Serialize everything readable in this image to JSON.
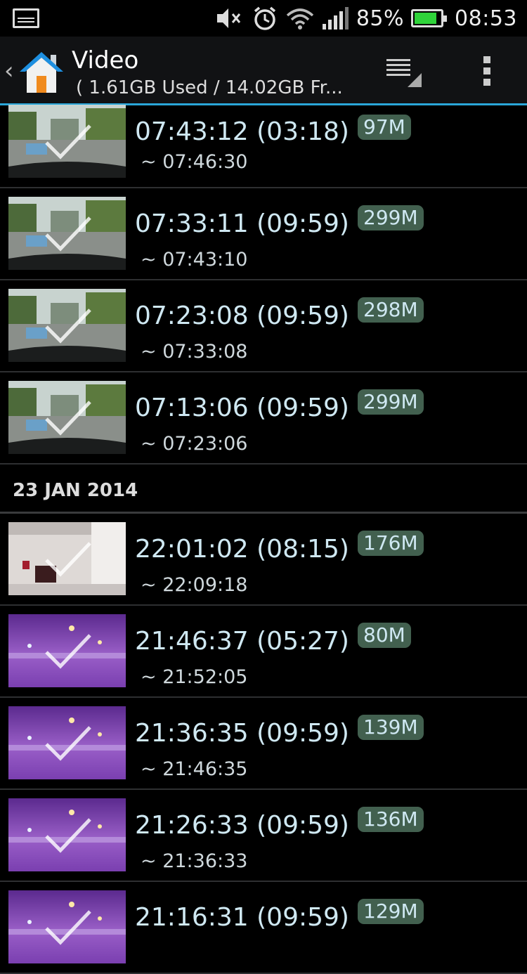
{
  "status_bar": {
    "battery_percent_text": "85%",
    "battery_level": 0.85,
    "clock": "08:53",
    "icons": [
      "notification-icon",
      "mute-icon",
      "alarm-icon",
      "wifi-icon",
      "signal-icon",
      "battery-icon"
    ]
  },
  "action_bar": {
    "title": "Video",
    "subtitle": "( 1.61GB Used / 14.02GB Fr...",
    "icons": [
      "back-chevron-icon",
      "home-icon",
      "list-menu-icon",
      "overflow-menu-icon"
    ]
  },
  "colors": {
    "accent": "#2aa6d8",
    "badge_bg": "#42604f",
    "text_primary": "#cfe8f2"
  },
  "list": {
    "group1_items": [
      {
        "start": "07:43:12 (03:18)",
        "size": "97M",
        "end": "~ 07:46:30",
        "thumb": "day"
      },
      {
        "start": "07:33:11 (09:59)",
        "size": "299M",
        "end": "~ 07:43:10",
        "thumb": "day"
      },
      {
        "start": "07:23:08 (09:59)",
        "size": "298M",
        "end": "~ 07:33:08",
        "thumb": "day"
      },
      {
        "start": "07:13:06 (09:59)",
        "size": "299M",
        "end": "~ 07:23:06",
        "thumb": "day"
      }
    ],
    "section_header": "23 JAN 2014",
    "group2_items": [
      {
        "start": "22:01:02 (08:15)",
        "size": "176M",
        "end": "~ 22:09:18",
        "thumb": "room"
      },
      {
        "start": "21:46:37 (05:27)",
        "size": "80M",
        "end": "~ 21:52:05",
        "thumb": "night"
      },
      {
        "start": "21:36:35 (09:59)",
        "size": "139M",
        "end": "~ 21:46:35",
        "thumb": "night"
      },
      {
        "start": "21:26:33 (09:59)",
        "size": "136M",
        "end": "~ 21:36:33",
        "thumb": "night"
      },
      {
        "start": "21:16:31 (09:59)",
        "size": "129M",
        "end": "",
        "thumb": "night"
      }
    ]
  }
}
